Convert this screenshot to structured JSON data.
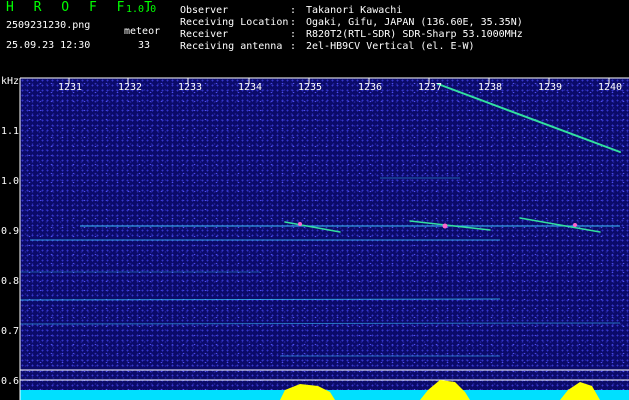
{
  "app": {
    "name": "H R O F F T",
    "version": "1.0.0",
    "filename": "2509231230.png",
    "datetime": "25.09.23 12:30",
    "detection_label": "meteor",
    "detection_count": "33"
  },
  "info": {
    "rows": [
      {
        "label": "Observer",
        "sep": ":",
        "value": "Takanori Kawachi"
      },
      {
        "label": "Receiving Location",
        "sep": ":",
        "value": "Ogaki, Gifu, JAPAN (136.60E, 35.35N)"
      },
      {
        "label": "Receiver",
        "sep": ":",
        "value": "R820T2(RTL-SDR) SDR-Sharp 53.1000MHz"
      },
      {
        "label": "Receiving antenna",
        "sep": ":",
        "value": "2el-HB9CV Vertical (el. E-W)"
      }
    ]
  },
  "plot": {
    "y_unit": "kHz",
    "y_ticks": [
      "1.1",
      "1.0",
      "0.9",
      "0.8",
      "0.7",
      "0.6"
    ],
    "x_ticks": [
      "1231",
      "1232",
      "1233",
      "1234",
      "1235",
      "1236",
      "1237",
      "1238",
      "1239",
      "1240"
    ],
    "colors": {
      "background": "#0b0b6a",
      "axis_text": "#ffffff",
      "trace": "#3cc8ff",
      "meteor_trail": "#33e0a0",
      "meteor_head": "#ff66cc",
      "level_fill": "#00e0ff",
      "level_peak": "#ffff00"
    }
  }
}
